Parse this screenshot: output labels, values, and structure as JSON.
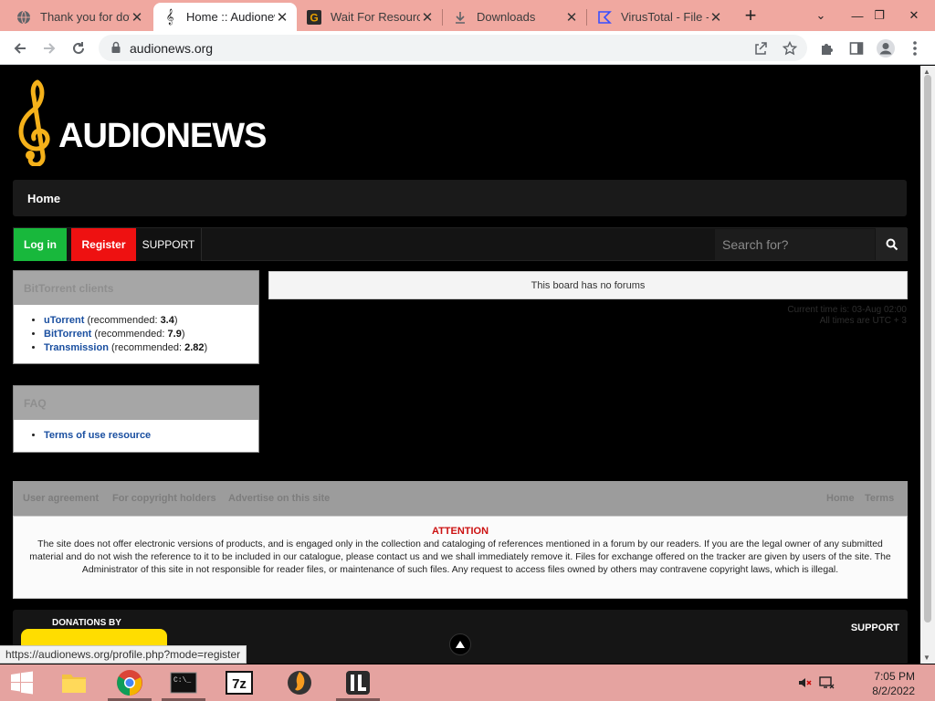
{
  "browser": {
    "tabs": [
      {
        "title": "Thank you for dow",
        "favicon": "globe-icon",
        "active": false
      },
      {
        "title": "Home :: Audionew",
        "favicon": "treble-clef-icon",
        "active": true
      },
      {
        "title": "Wait For Resourc",
        "favicon": "g-logo-icon",
        "active": false
      },
      {
        "title": "Downloads",
        "favicon": "download-icon",
        "active": false
      },
      {
        "title": "VirusTotal - File -",
        "favicon": "virustotal-icon",
        "active": false
      }
    ],
    "address": "audionews.org",
    "status_url": "https://audionews.org/profile.php?mode=register"
  },
  "site": {
    "logo_text": "AUDIONEWS",
    "nav_home": "Home",
    "login": "Log in",
    "register": "Register",
    "support": "SUPPORT",
    "search_placeholder": "Search for?",
    "clients_block": {
      "title": "BitTorrent clients",
      "items": [
        {
          "name": "uTorrent",
          "pre": " (recommended: ",
          "version": "3.4",
          "post": ")"
        },
        {
          "name": "BitTorrent",
          "pre": " (recommended: ",
          "version": "7.9",
          "post": ")"
        },
        {
          "name": "Transmission",
          "pre": " (recommended: ",
          "version": "2.82",
          "post": ")"
        }
      ]
    },
    "faq_block": {
      "title": "FAQ",
      "items": [
        "Terms of use resource"
      ]
    },
    "no_forums": "This board has no forums",
    "current_time": "Current time is: 03-Aug 02:00",
    "all_times": "All times are UTC + 3",
    "footer_links_left": [
      "User agreement",
      "For copyright holders",
      "Advertise on this site"
    ],
    "footer_links_right": [
      "Home",
      "Terms"
    ],
    "attention": "ATTENTION",
    "disclaimer": "The site does not offer electronic versions of products, and is engaged only in the collection and cataloging of references mentioned in a forum by our readers. If you are the legal owner of any submitted material and do not wish the reference to it to be included in our catalogue, please contact us and we shall immediately remove it. Files for exchange offered on the tracker are given by users of the site. The Administrator of this site in not responsible for reader files, or maintenance of such files. Any request to access files owned by others may contravene copyright laws, which is illegal.",
    "donations_label": "DONATIONS BY",
    "footer_support": "SUPPORT"
  },
  "taskbar": {
    "apps": [
      "file-explorer-icon",
      "chrome-icon",
      "command-prompt-icon",
      "7zip-icon",
      "fl-studio-icon",
      "il-app-icon"
    ],
    "time": "7:05 PM",
    "date": "8/2/2022"
  }
}
